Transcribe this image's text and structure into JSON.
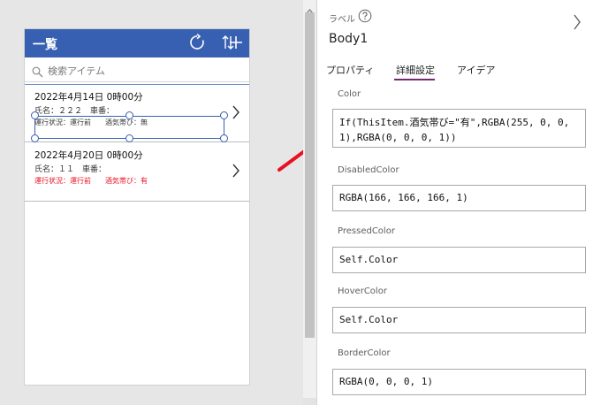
{
  "app": {
    "title": "一覧",
    "search_placeholder": "検索アイテム"
  },
  "gallery": {
    "items": [
      {
        "date": "2022年4月14日 0時00分",
        "name_line": "氏名：２２２　車番：",
        "status": "運行状況：運行前",
        "alcohol": "酒気帯び：無"
      },
      {
        "date": "2022年4月20日 0時00分",
        "name_line": "氏名：１１　車番：",
        "status": "運行状況：運行前",
        "alcohol": "酒気帯び：有"
      }
    ]
  },
  "panel": {
    "type_label": "ラベル",
    "control_name": "Body1",
    "tabs": {
      "properties": "プロパティ",
      "advanced": "詳細設定",
      "ideas": "アイデア"
    },
    "props": [
      {
        "label": "Color",
        "value": "If(ThisItem.酒気帯び=\"有\",RGBA(255, 0, 0, 1),RGBA(0, 0, 0, 1))"
      },
      {
        "label": "DisabledColor",
        "value": "RGBA(166, 166, 166, 1)"
      },
      {
        "label": "PressedColor",
        "value": "Self.Color"
      },
      {
        "label": "HoverColor",
        "value": "Self.Color"
      },
      {
        "label": "BorderColor",
        "value": "RGBA(0, 0, 0, 1)"
      }
    ]
  },
  "colors": {
    "header_blue": "#3860b2",
    "alert_red": "#e81123",
    "tab_underline": "#742774",
    "arrow_red": "#e81123"
  },
  "icons": [
    "refresh-icon",
    "sort-icon",
    "add-icon",
    "search-icon",
    "chevron-right-icon",
    "help-icon",
    "annotation-arrow"
  ]
}
